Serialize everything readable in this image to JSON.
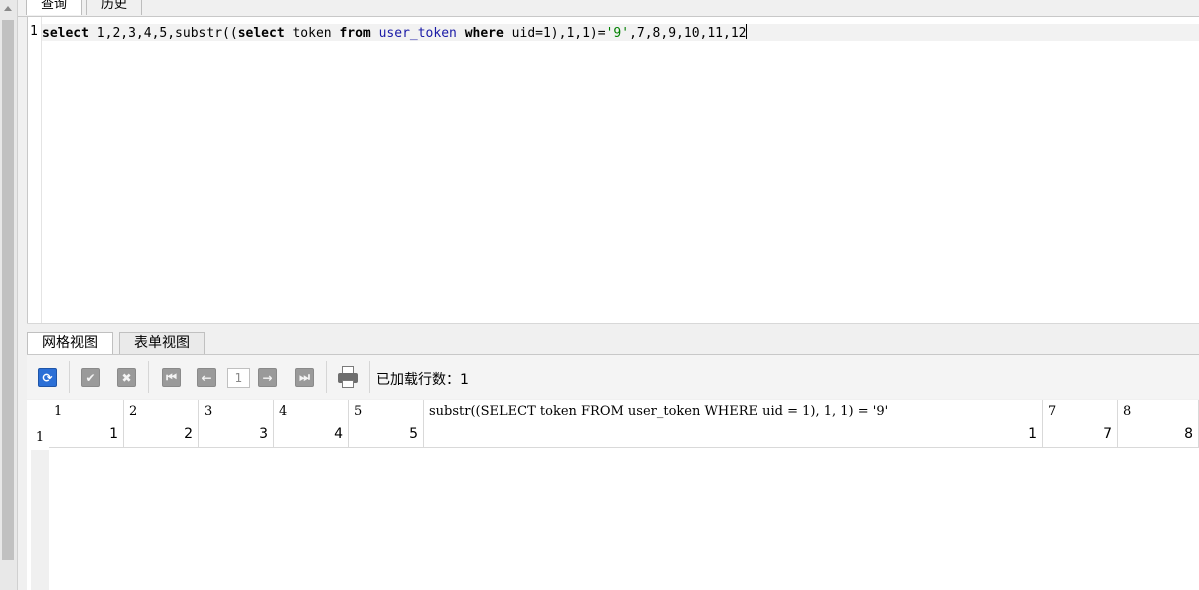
{
  "top_tabs": [
    {
      "label": "查询",
      "active": true
    },
    {
      "label": "历史",
      "active": false
    }
  ],
  "editor": {
    "line_number": "1",
    "tokens": [
      {
        "text": "select",
        "kind": "kw"
      },
      {
        "text": " 1,2,3,4,5,substr((",
        "kind": "plain"
      },
      {
        "text": "select",
        "kind": "kw"
      },
      {
        "text": " token ",
        "kind": "plain"
      },
      {
        "text": "from",
        "kind": "kw"
      },
      {
        "text": " ",
        "kind": "plain"
      },
      {
        "text": "user_token",
        "kind": "ident"
      },
      {
        "text": " ",
        "kind": "plain"
      },
      {
        "text": "where",
        "kind": "kw"
      },
      {
        "text": " uid=1),1,1)=",
        "kind": "plain"
      },
      {
        "text": "'9'",
        "kind": "str"
      },
      {
        "text": ",7,8,9,10,11,12",
        "kind": "plain"
      }
    ]
  },
  "result_tabs": [
    {
      "label": "网格视图",
      "active": true
    },
    {
      "label": "表单视图",
      "active": false
    }
  ],
  "toolbar": {
    "refresh_icon": "refresh-icon",
    "apply_icon": "check-icon",
    "discard_icon": "x-icon",
    "first_icon": "first-page-icon",
    "prev_icon": "prev-page-icon",
    "page_value": "1",
    "next_icon": "next-page-icon",
    "last_icon": "last-page-icon",
    "print_icon": "print-icon",
    "loaded_text": "已加载行数：1"
  },
  "grid": {
    "columns": [
      "1",
      "2",
      "3",
      "4",
      "5",
      "substr((SELECT token FROM user_token WHERE uid = 1), 1, 1) = '9'",
      "7",
      "8"
    ],
    "rows": [
      {
        "row_number": "1",
        "values": [
          "1",
          "2",
          "3",
          "4",
          "5",
          "1",
          "7",
          "8"
        ]
      }
    ]
  },
  "colors": {
    "keyword": "#000000",
    "identifier": "#1a1aa6",
    "string": "#008000",
    "refresh_button": "#2b6fd6"
  }
}
